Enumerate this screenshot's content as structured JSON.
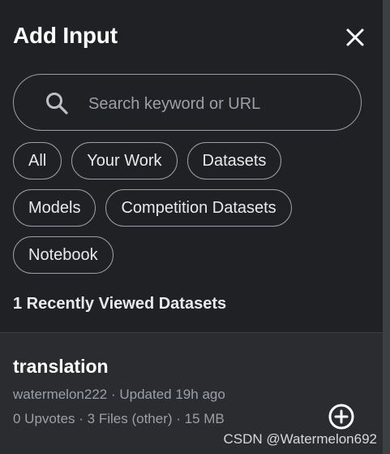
{
  "header": {
    "title": "Add Input",
    "close_icon": "close-icon"
  },
  "search": {
    "placeholder": "Search keyword or URL",
    "value": "",
    "icon": "search-icon"
  },
  "filters": {
    "rows": [
      [
        "All",
        "Your Work",
        "Datasets"
      ],
      [
        "Models",
        "Competition Datasets"
      ],
      [
        "Notebook"
      ]
    ]
  },
  "recent": {
    "heading": "1 Recently Viewed Datasets",
    "items": [
      {
        "name": "translation",
        "owner": "watermelon222",
        "separator": " · ",
        "updated": "Updated 19h ago",
        "upvotes": "0 Upvotes",
        "files": "3 Files (other)",
        "size": "15 MB",
        "action_icon": "add-circle-icon"
      }
    ]
  },
  "watermark": "CSDN @Watermelon692",
  "colors": {
    "background": "#202124",
    "card": "#2b2c2f",
    "border": "#9aa0a6",
    "text": "#e8eaed",
    "muted": "#9aa0a6"
  }
}
